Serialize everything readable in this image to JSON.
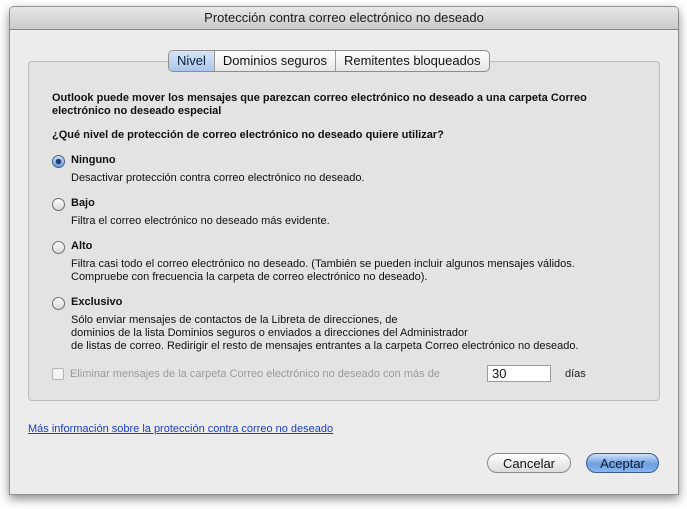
{
  "window": {
    "title": "Protección contra correo electrónico no deseado"
  },
  "tabs": [
    {
      "label": "Nivel",
      "active": true
    },
    {
      "label": "Dominios seguros",
      "active": false
    },
    {
      "label": "Remitentes bloqueados",
      "active": false
    }
  ],
  "intro": {
    "description": "Outlook puede mover los mensajes que parezcan correo electrónico no deseado a una carpeta Correo electrónico no deseado especial",
    "question": "¿Qué nivel de protección de correo electrónico no deseado quiere utilizar?"
  },
  "levels": [
    {
      "label": "Ninguno",
      "description": "Desactivar protección contra correo electrónico no deseado.",
      "selected": true
    },
    {
      "label": "Bajo",
      "description": "Filtra el correo electrónico no deseado más evidente.",
      "selected": false
    },
    {
      "label": "Alto",
      "description": "Filtra casi todo el correo electrónico no deseado.  (También se pueden incluir algunos mensajes válidos.\nCompruebe con frecuencia la carpeta de correo electrónico no deseado).",
      "selected": false
    },
    {
      "label": "Exclusivo",
      "description": "Sólo enviar mensajes de contactos de la Libreta de direcciones, de\ndominios de la lista Dominios seguros o enviados a direcciones del Administrador\nde listas de correo. Redirigir el resto de mensajes entrantes a la carpeta Correo electrónico no deseado.",
      "selected": false
    }
  ],
  "delete_option": {
    "label": "Eliminar mensajes de la carpeta Correo electrónico no deseado con más de",
    "days_value": "30",
    "days_unit": "días",
    "enabled": false,
    "checked": false
  },
  "more_info_link": "Más información sobre la protección contra correo no deseado",
  "buttons": {
    "cancel": "Cancelar",
    "accept": "Aceptar"
  },
  "colors": {
    "accent": "#6f9fe0",
    "link": "#1b3fc9"
  }
}
